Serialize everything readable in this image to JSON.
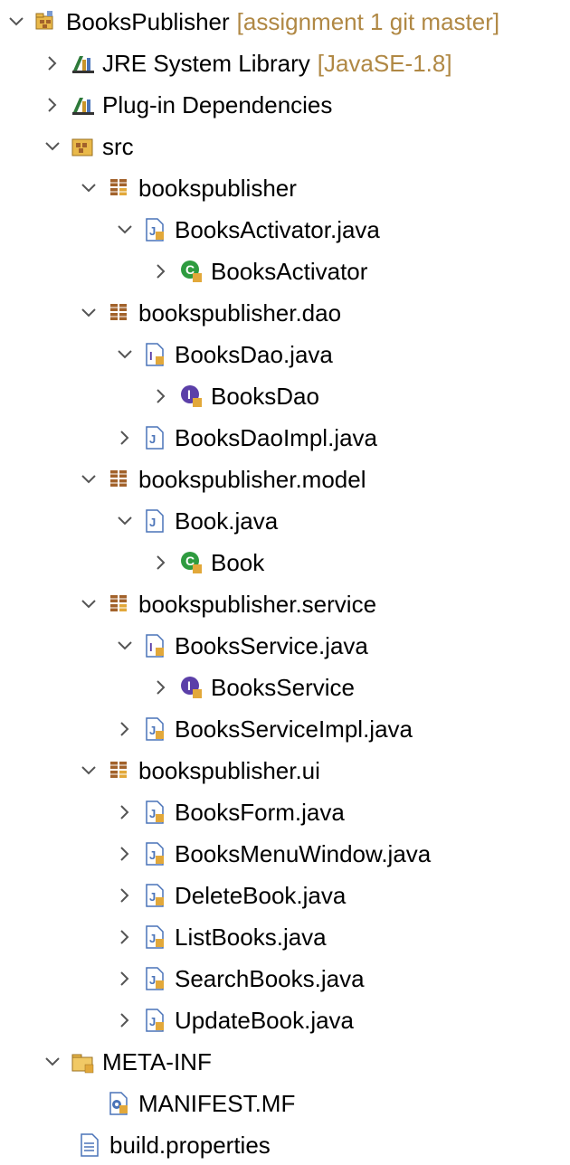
{
  "tree": {
    "items": [
      {
        "label": "BooksPublisher",
        "decoration": "[assignment 1 git master]",
        "icon": "project-icon",
        "toggle": "expanded"
      },
      {
        "label": "JRE System Library",
        "decoration": "[JavaSE-1.8]",
        "icon": "library-icon",
        "toggle": "collapsed"
      },
      {
        "label": "Plug-in Dependencies",
        "icon": "library-icon",
        "toggle": "collapsed"
      },
      {
        "label": "src",
        "icon": "source-folder-icon",
        "toggle": "expanded"
      },
      {
        "label": "bookspublisher",
        "icon": "package-icon",
        "toggle": "expanded"
      },
      {
        "label": "BooksActivator.java",
        "icon": "java-file-icon",
        "toggle": "expanded"
      },
      {
        "label": "BooksActivator",
        "icon": "class-icon",
        "toggle": "collapsed"
      },
      {
        "label": "bookspublisher.dao",
        "icon": "package-icon",
        "toggle": "expanded"
      },
      {
        "label": "BooksDao.java",
        "icon": "java-interface-file-icon",
        "toggle": "expanded"
      },
      {
        "label": "BooksDao",
        "icon": "interface-icon",
        "toggle": "collapsed"
      },
      {
        "label": "BooksDaoImpl.java",
        "icon": "java-file-icon",
        "toggle": "collapsed"
      },
      {
        "label": "bookspublisher.model",
        "icon": "package-icon",
        "toggle": "expanded"
      },
      {
        "label": "Book.java",
        "icon": "java-file-icon",
        "toggle": "expanded"
      },
      {
        "label": "Book",
        "icon": "class-icon",
        "toggle": "collapsed"
      },
      {
        "label": "bookspublisher.service",
        "icon": "package-icon",
        "toggle": "expanded"
      },
      {
        "label": "BooksService.java",
        "icon": "java-interface-file-icon",
        "toggle": "expanded"
      },
      {
        "label": "BooksService",
        "icon": "interface-icon",
        "toggle": "collapsed"
      },
      {
        "label": "BooksServiceImpl.java",
        "icon": "java-file-icon",
        "toggle": "collapsed"
      },
      {
        "label": "bookspublisher.ui",
        "icon": "package-icon",
        "toggle": "expanded"
      },
      {
        "label": "BooksForm.java",
        "icon": "java-file-icon",
        "toggle": "collapsed"
      },
      {
        "label": "BooksMenuWindow.java",
        "icon": "java-file-icon",
        "toggle": "collapsed"
      },
      {
        "label": "DeleteBook.java",
        "icon": "java-file-icon",
        "toggle": "collapsed"
      },
      {
        "label": "ListBooks.java",
        "icon": "java-file-icon",
        "toggle": "collapsed"
      },
      {
        "label": "SearchBooks.java",
        "icon": "java-file-icon",
        "toggle": "collapsed"
      },
      {
        "label": "UpdateBook.java",
        "icon": "java-file-icon",
        "toggle": "collapsed"
      },
      {
        "label": "META-INF",
        "icon": "folder-icon",
        "toggle": "expanded"
      },
      {
        "label": "MANIFEST.MF",
        "icon": "manifest-file-icon",
        "toggle": "none"
      },
      {
        "label": "build.properties",
        "icon": "properties-file-icon",
        "toggle": "none"
      }
    ]
  },
  "colors": {
    "decoration": "#b08844",
    "class_green": "#2e9b3f",
    "interface_purple": "#5b3fa8",
    "package_brown": "#a2622b",
    "package_gold": "#e2a83a",
    "toggle": "#555555"
  }
}
